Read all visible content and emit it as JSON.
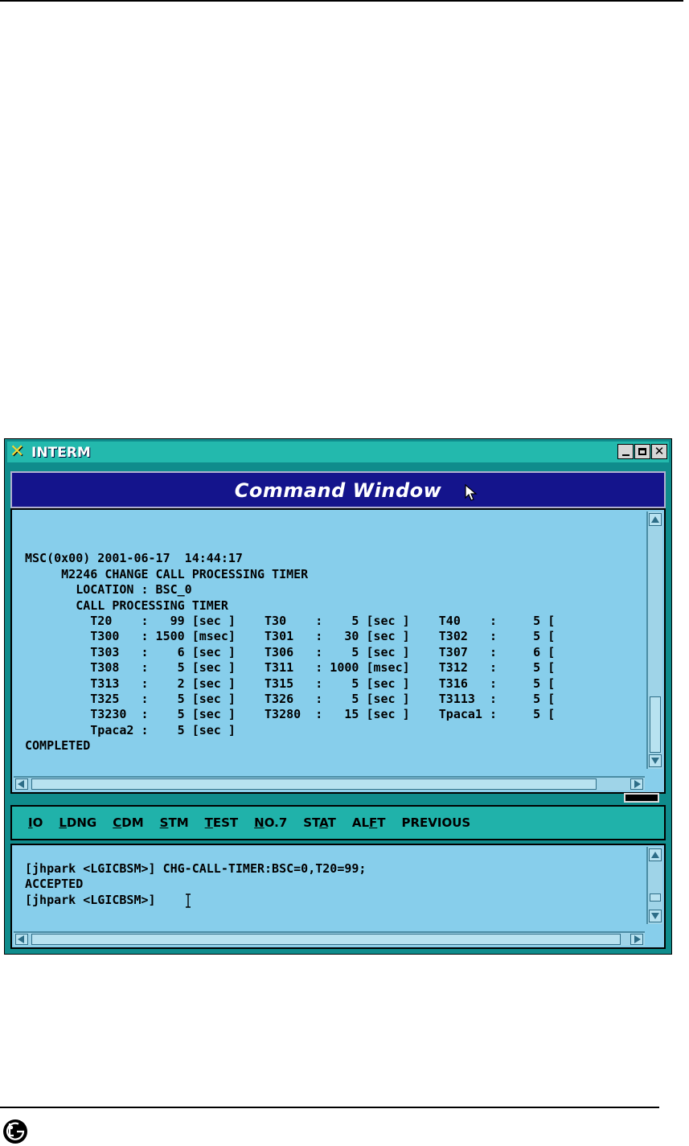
{
  "window": {
    "title": "INTERM",
    "header_title": "Command Window"
  },
  "output": {
    "lines": [
      "",
      "MSC(0x00) 2001-06-17  14:44:17",
      "     M2246 CHANGE CALL PROCESSING TIMER",
      "       LOCATION : BSC_0",
      "       CALL PROCESSING TIMER",
      "         T20    :   99 [sec ]    T30    :    5 [sec ]    T40    :     5 [",
      "         T300   : 1500 [msec]    T301   :   30 [sec ]    T302   :     5 [",
      "         T303   :    6 [sec ]    T306   :    5 [sec ]    T307   :     6 [",
      "         T308   :    5 [sec ]    T311   : 1000 [msec]    T312   :     5 [",
      "         T313   :    2 [sec ]    T315   :    5 [sec ]    T316   :     5 [",
      "         T325   :    5 [sec ]    T326   :    5 [sec ]    T3113  :     5 [",
      "         T3230  :    5 [sec ]    T3280  :   15 [sec ]    Tpaca1 :     5 [",
      "         Tpaca2 :    5 [sec ]",
      "COMPLETED"
    ]
  },
  "menu": {
    "items": [
      {
        "pre": "",
        "u": "I",
        "post": "O"
      },
      {
        "pre": "",
        "u": "L",
        "post": "DNG"
      },
      {
        "pre": "",
        "u": "C",
        "post": "DM"
      },
      {
        "pre": "",
        "u": "S",
        "post": "TM"
      },
      {
        "pre": "",
        "u": "T",
        "post": "EST"
      },
      {
        "pre": "",
        "u": "N",
        "post": "O.7"
      },
      {
        "pre": "ST",
        "u": "A",
        "post": "T"
      },
      {
        "pre": "AL",
        "u": "F",
        "post": "T"
      },
      {
        "pre": "PREVIOUS",
        "u": "",
        "post": ""
      }
    ]
  },
  "input": {
    "lines": [
      "[jhpark <LGICBSM>] CHG-CALL-TIMER:BSC=0,T20=99;",
      "ACCEPTED",
      "[jhpark <LGICBSM>] "
    ]
  },
  "colors": {
    "frame": "#0f8c8c",
    "titlebar": "#23b9ad",
    "header": "#14148c",
    "panel": "#87ceeb",
    "menu": "#20b2aa"
  },
  "icons": [
    "x-logo-icon",
    "minimize-icon",
    "maximize-icon",
    "close-icon",
    "mouse-pointer-icon",
    "text-cursor-icon",
    "lg-logo-icon"
  ]
}
